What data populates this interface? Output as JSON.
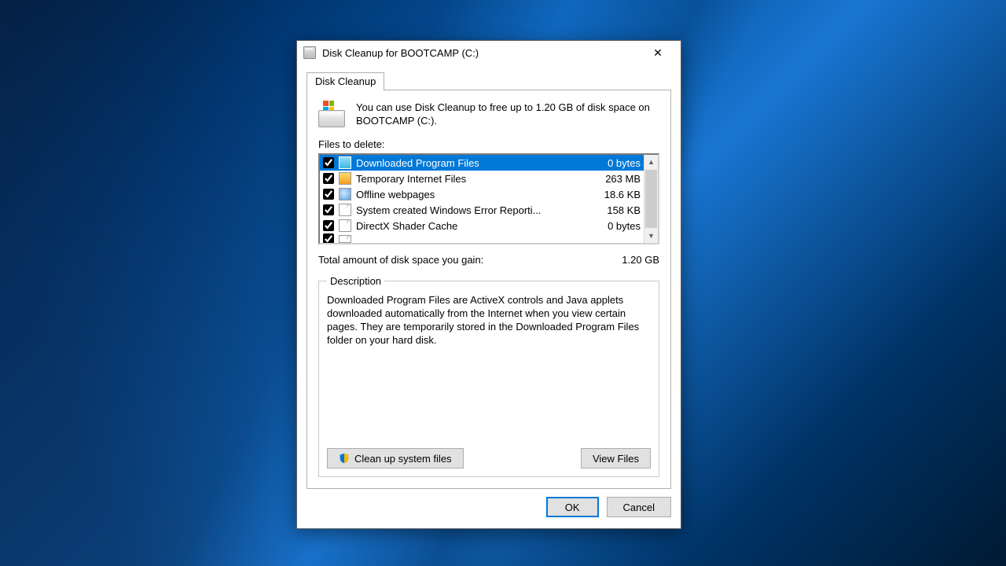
{
  "titlebar": {
    "title": "Disk Cleanup for BOOTCAMP (C:)"
  },
  "tab": {
    "label": "Disk Cleanup"
  },
  "intro": "You can use Disk Cleanup to free up to 1.20 GB of disk space on BOOTCAMP (C:).",
  "files_label": "Files to delete:",
  "items": [
    {
      "name": "Downloaded Program Files",
      "size": "0 bytes",
      "icon": "folder",
      "checked": true,
      "selected": true
    },
    {
      "name": "Temporary Internet Files",
      "size": "263 MB",
      "icon": "lock",
      "checked": true,
      "selected": false
    },
    {
      "name": "Offline webpages",
      "size": "18.6 KB",
      "icon": "web",
      "checked": true,
      "selected": false
    },
    {
      "name": "System created Windows Error Reporti...",
      "size": "158 KB",
      "icon": "page",
      "checked": true,
      "selected": false
    },
    {
      "name": "DirectX Shader Cache",
      "size": "0 bytes",
      "icon": "page",
      "checked": true,
      "selected": false
    }
  ],
  "total": {
    "label": "Total amount of disk space you gain:",
    "value": "1.20 GB"
  },
  "description": {
    "legend": "Description",
    "text": "Downloaded Program Files are ActiveX controls and Java applets downloaded automatically from the Internet when you view certain pages. They are temporarily stored in the Downloaded Program Files folder on your hard disk."
  },
  "buttons": {
    "clean_system": "Clean up system files",
    "view_files": "View Files",
    "ok": "OK",
    "cancel": "Cancel"
  }
}
